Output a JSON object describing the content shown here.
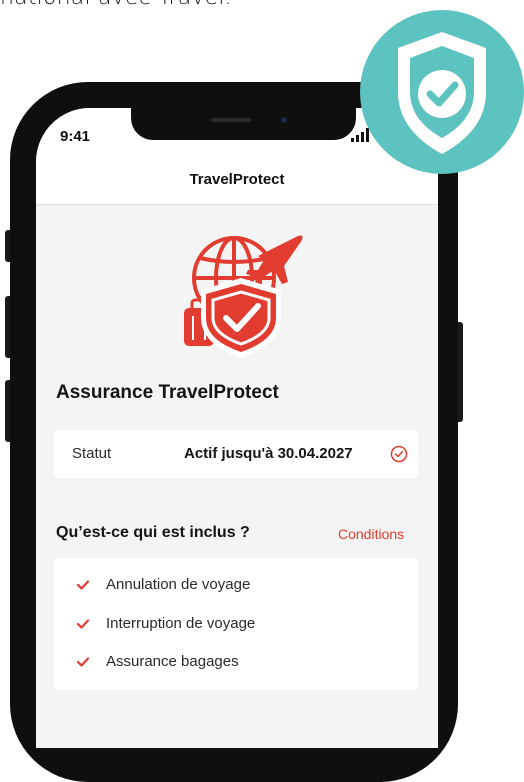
{
  "caption": "national avec Travel.",
  "phone": {
    "time": "9:41",
    "app_title": "TravelProtect"
  },
  "hero_icon": "travel-insurance-globe-plane-shield-luggage-icon",
  "insurance": {
    "title": "Assurance TravelProtect",
    "status_label": "Statut",
    "status_value": "Actif jusqu'à 30.04.2027"
  },
  "included": {
    "title": "Qu’est-ce qui est inclus ?",
    "conditions_label": "Conditions",
    "items": [
      {
        "label": "Annulation de voyage"
      },
      {
        "label": "Interruption de voyage"
      },
      {
        "label": "Assurance bagages"
      }
    ]
  },
  "colors": {
    "accent_red": "#e23b2f",
    "badge_teal": "#5cc3c0",
    "phone_frame": "#0f0f10",
    "screen_bg": "#f4f4f4"
  }
}
